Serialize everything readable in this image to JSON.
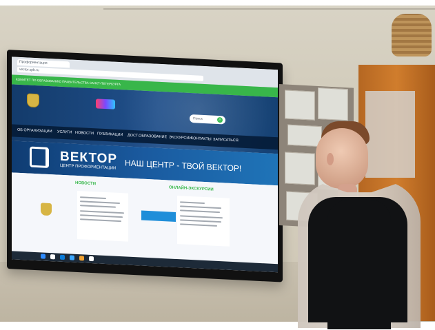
{
  "screen": {
    "tab": "Профориентация",
    "url": "vector.spb.ru",
    "green_strip": "КОМИТЕТ ПО ОБРАЗОВАНИЮ ПРАВИТЕЛЬСТВА САНКТ-ПЕТЕРБУРГА",
    "search_placeholder": "Поиск",
    "menu_items": [
      "ОБ ОРГАНИЗАЦИИ",
      "УСЛУГИ",
      "НОВОСТИ",
      "ПУБЛИКАЦИИ",
      "ДОСТ.ОБРАЗОВАНИЕ",
      "ЭКСКУРСИИ",
      "КОНТАКТЫ",
      "ЗАПИСАТЬСЯ"
    ],
    "banner": {
      "title": "ВЕКТОР",
      "subtitle": "ЦЕНТР ПРОФОРИЕНТАЦИИ",
      "slogan": "НАШ ЦЕНТР - ТВОЙ ВЕКТОР!"
    },
    "sections": {
      "news": "НОВОСТИ",
      "tours": "ОНЛАЙН-ЭКСКУРСИИ"
    }
  },
  "colors": {
    "green": "#38b64a",
    "hero_blue": "#133b6b",
    "banner_blue": "#1a5a9f",
    "cabinet": "#c9772a"
  }
}
